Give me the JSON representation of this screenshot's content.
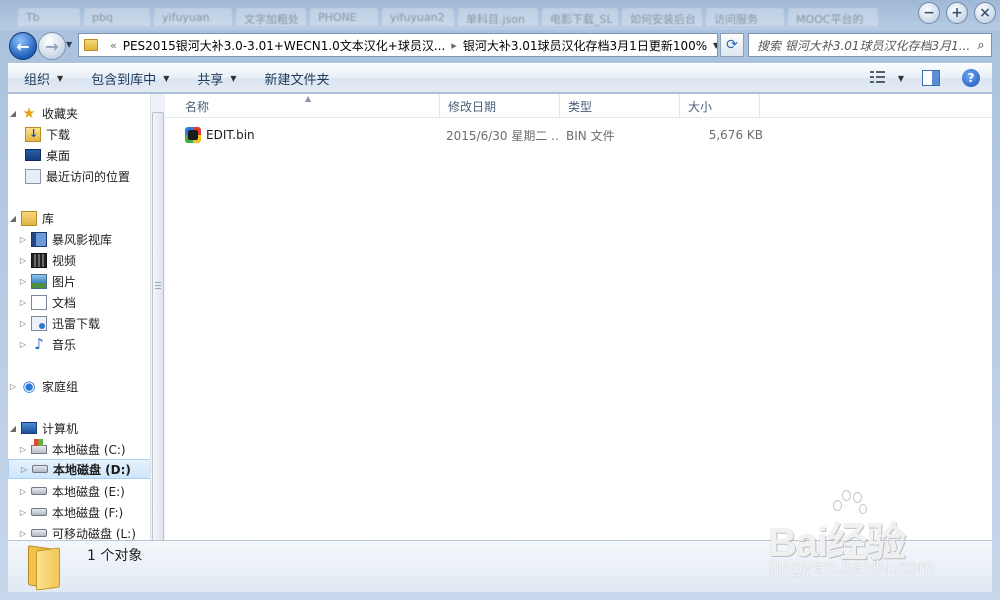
{
  "background_tabs": [
    "Tb",
    "pbq",
    "yifuyuan",
    "文字加粗处",
    "PHONE",
    "yifuyuan2",
    "单科目.json",
    "电影下载_SL",
    "如何安装后台",
    "访问服务",
    "MOOC平台的"
  ],
  "window_buttons": {
    "minimize": "−",
    "maximize": "+",
    "close": "×"
  },
  "nav": {
    "back_glyph": "←",
    "forward_glyph": "→",
    "breadcrumb_overflow": "«",
    "breadcrumbs": [
      "PES2015银河大补3.0-3.01+WECN1.0文本汉化+球员汉...",
      "银河大补3.01球员汉化存档3月1日更新100%"
    ],
    "separator": "▸",
    "refresh_glyph": "⟳",
    "search_placeholder": "搜索 银河大补3.01球员汉化存档3月1...",
    "search_icon": "magnifier-icon"
  },
  "commands": {
    "organize": "组织",
    "include_in_library": "包含到库中",
    "share": "共享",
    "new_folder": "新建文件夹",
    "help": "?"
  },
  "tree": {
    "favorites": "收藏夹",
    "downloads": "下载",
    "desktop": "桌面",
    "recent": "最近访问的位置",
    "libraries": "库",
    "storm": "暴风影视库",
    "videos": "视频",
    "pictures": "图片",
    "documents": "文档",
    "xunlei": "迅雷下载",
    "music": "音乐",
    "homegroup": "家庭组",
    "computer": "计算机",
    "drive_c": "本地磁盘 (C:)",
    "drive_d": "本地磁盘 (D:)",
    "drive_e": "本地磁盘 (E:)",
    "drive_f": "本地磁盘 (F:)",
    "drive_l": "可移动磁盘 (L:)"
  },
  "columns": {
    "name": "名称",
    "modified": "修改日期",
    "type": "类型",
    "size": "大小"
  },
  "files": [
    {
      "name": "EDIT.bin",
      "modified": "2015/6/30 星期二 ...",
      "type": "BIN 文件",
      "size": "5,676 KB"
    }
  ],
  "status": {
    "count_text": "1 个对象"
  },
  "watermark": {
    "logo": "Bai经验",
    "url": "jingyan.baidu.com"
  },
  "colors": {
    "accent": "#1f5fb8",
    "selection": "#cde6fb",
    "folder": "#f2c757"
  }
}
